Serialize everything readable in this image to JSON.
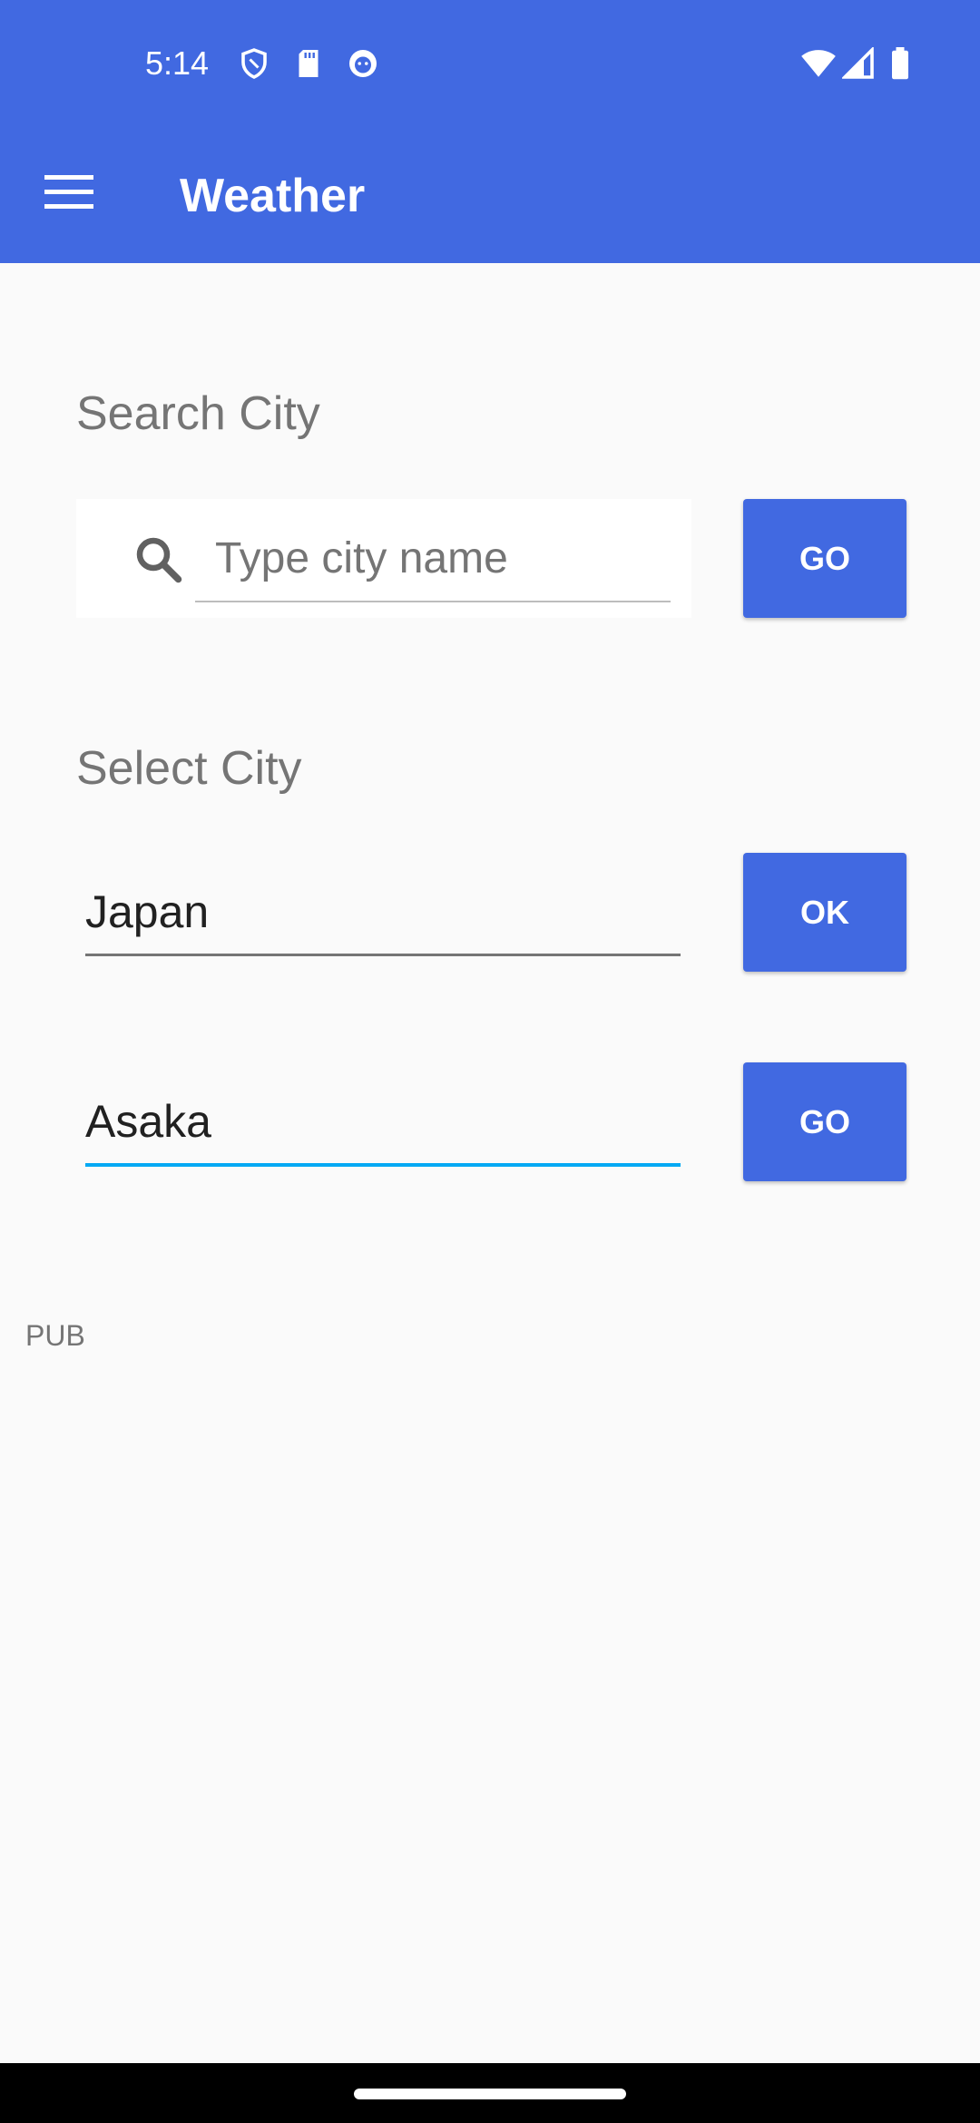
{
  "status_bar": {
    "time": "5:14",
    "left_icons": [
      "shield-icon",
      "sd-card-icon",
      "face-icon"
    ],
    "right_icons": [
      "wifi-icon",
      "cell-signal-icon",
      "battery-icon"
    ]
  },
  "app_bar": {
    "title": "Weather",
    "menu_icon": "hamburger-menu-icon"
  },
  "search_section": {
    "title": "Search City",
    "input_placeholder": "Type city name",
    "input_value": "",
    "button_label": "GO"
  },
  "select_section": {
    "title": "Select City",
    "country_value": "Japan",
    "country_button_label": "OK",
    "city_value": "Asaka",
    "city_button_label": "GO"
  },
  "ad_label": "PUB",
  "colors": {
    "primary": "#4169e1",
    "accent_underline": "#03a9f4",
    "background": "#fafafa"
  }
}
